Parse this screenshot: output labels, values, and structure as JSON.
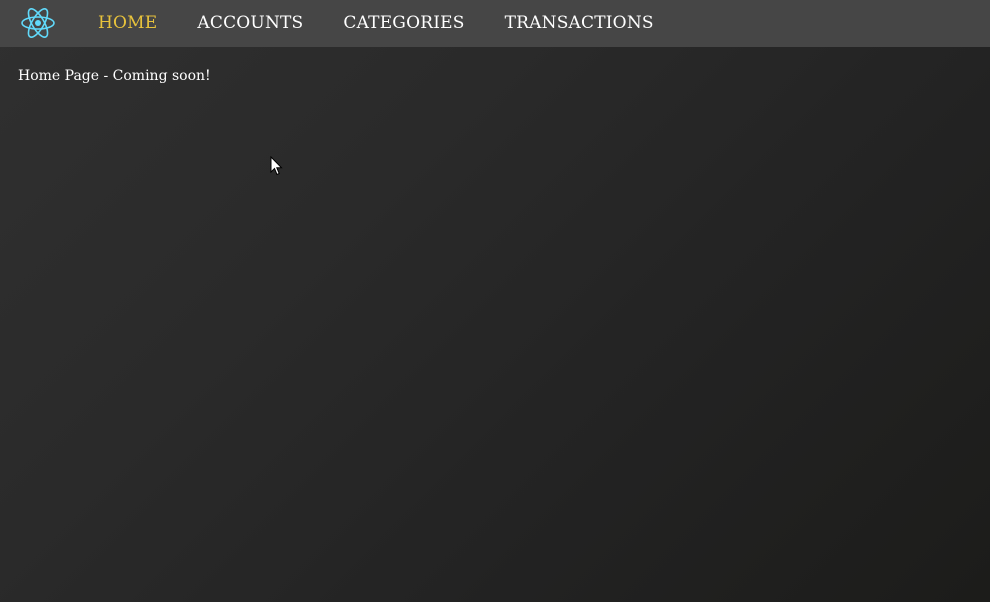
{
  "navbar": {
    "logo_icon": "react-atom-icon",
    "logo_color": "#61dafb",
    "active_color": "#e8c33c",
    "links": [
      {
        "label": "HOME",
        "active": true
      },
      {
        "label": "ACCOUNTS",
        "active": false
      },
      {
        "label": "CATEGORIES",
        "active": false
      },
      {
        "label": "TRANSACTIONS",
        "active": false
      }
    ]
  },
  "main": {
    "message": "Home Page - Coming soon!"
  }
}
